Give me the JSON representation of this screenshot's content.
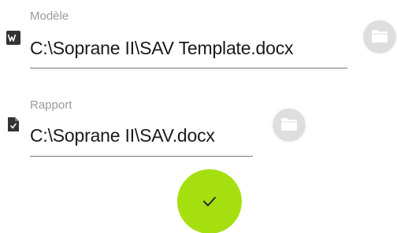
{
  "template_field": {
    "label": "Modèle",
    "value": "C:\\Soprane II\\SAV Template.docx",
    "file_icon": "word-document-icon",
    "browse_icon": "folder-icon"
  },
  "report_field": {
    "label": "Rapport",
    "value": "C:\\Soprane II\\SAV.docx",
    "file_icon": "document-icon",
    "browse_icon": "folder-icon"
  },
  "confirm": {
    "icon": "check-icon"
  },
  "colors": {
    "accent": "#a6df0f",
    "folder_button": "#dedede",
    "label": "#9a9a9a",
    "underline": "#7a7a7a",
    "text": "#1a1a1a"
  }
}
